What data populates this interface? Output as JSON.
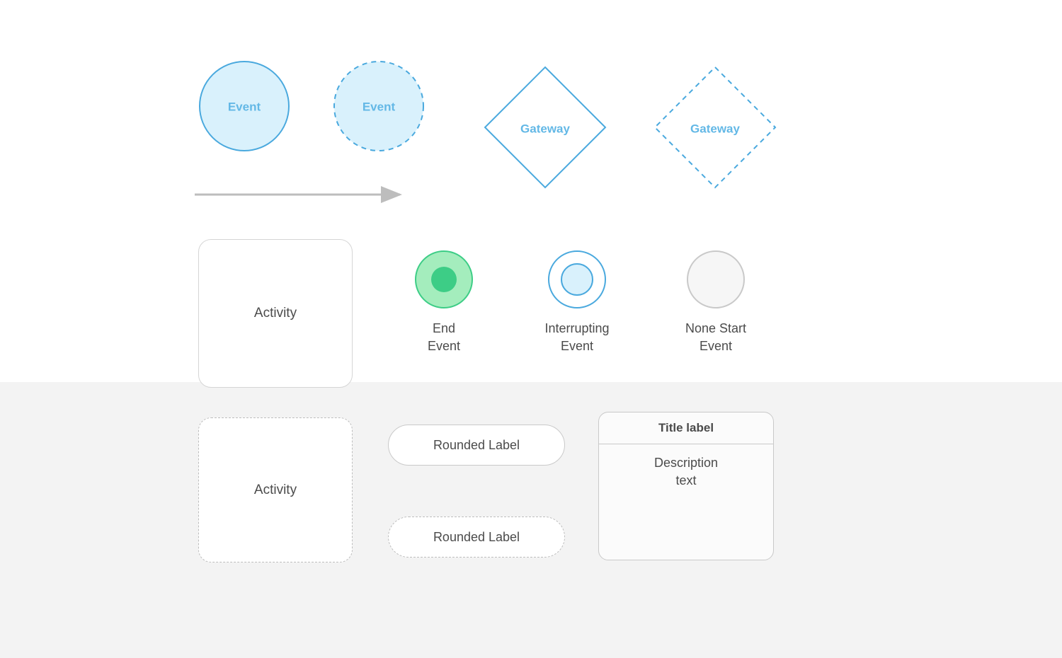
{
  "row1": {
    "event_solid": "Event",
    "event_dashed": "Event",
    "gateway_solid": "Gateway",
    "gateway_dashed": "Gateway"
  },
  "row2": {
    "activity": "Activity",
    "end_event": "End\nEvent",
    "interrupting_event": "Interrupting\nEvent",
    "none_start_event": "None Start\nEvent"
  },
  "row3": {
    "activity_dashed": "Activity",
    "rounded_label_solid": "Rounded Label",
    "rounded_label_dashed": "Rounded Label",
    "card_title": "Title label",
    "card_desc": "Description\ntext"
  },
  "colors": {
    "blue_stroke": "#4aa9de",
    "blue_fill": "#d9f1fc",
    "green_outer": "#a4edbd",
    "green_inner": "#3dcd86",
    "grey_stroke": "#c9c9c9",
    "grey_bg": "#f3f3f3"
  }
}
